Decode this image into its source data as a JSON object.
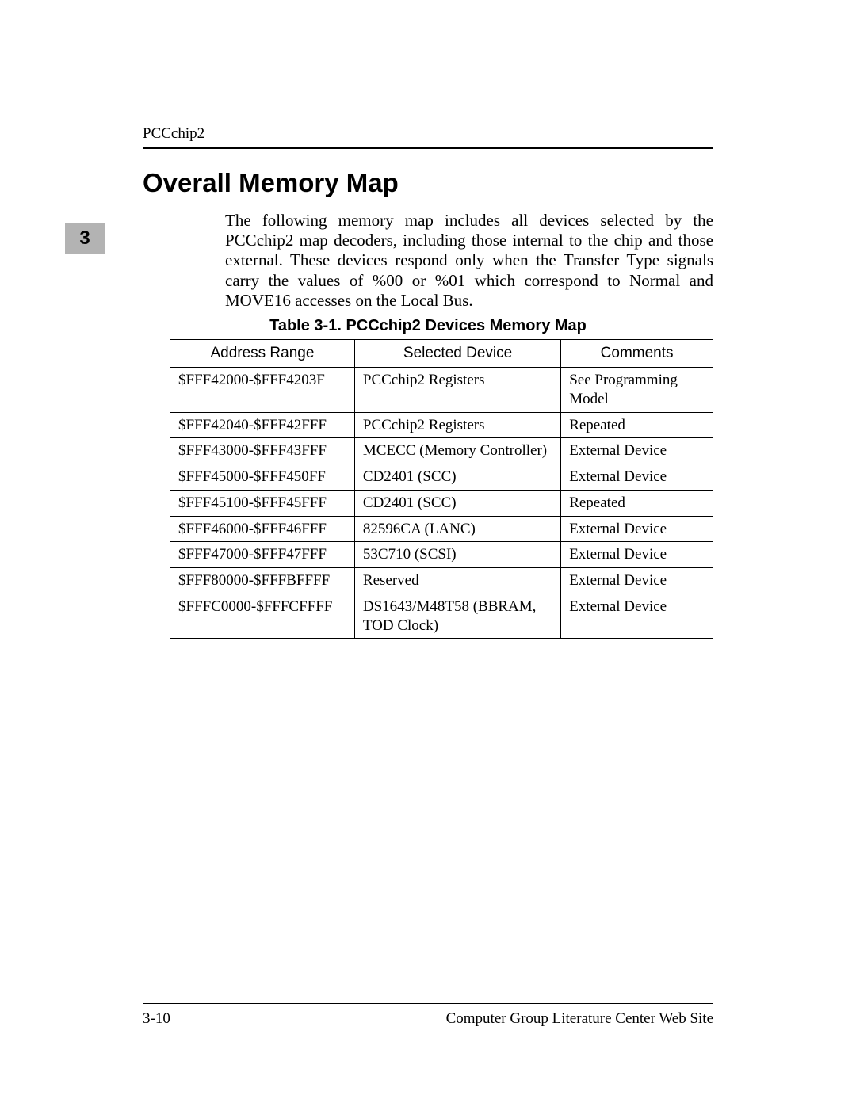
{
  "header": {
    "running_head": "PCCchip2",
    "chapter_tab": "3"
  },
  "section": {
    "title": "Overall Memory Map",
    "intro": "The following memory map includes all devices selected by the PCCchip2 map decoders, including those internal to the chip and those external. These devices respond only when the Transfer Type signals carry the values of %00 or %01 which correspond to Normal and MOVE16 accesses on the Local Bus."
  },
  "table": {
    "caption": "Table 3-1.  PCCchip2 Devices Memory Map",
    "headers": {
      "address": "Address Range",
      "device": "Selected Device",
      "comments": "Comments"
    },
    "rows": [
      {
        "address": "$FFF42000-$FFF4203F",
        "device": "PCCchip2 Registers",
        "comments": "See Programming Model"
      },
      {
        "address": "$FFF42040-$FFF42FFF",
        "device": "PCCchip2 Registers",
        "comments": "Repeated"
      },
      {
        "address": "$FFF43000-$FFF43FFF",
        "device": "MCECC (Memory Controller)",
        "comments": "External Device"
      },
      {
        "address": "$FFF45000-$FFF450FF",
        "device": "CD2401 (SCC)",
        "comments": "External Device"
      },
      {
        "address": "$FFF45100-$FFF45FFF",
        "device": "CD2401 (SCC)",
        "comments": "Repeated"
      },
      {
        "address": "$FFF46000-$FFF46FFF",
        "device": "82596CA (LANC)",
        "comments": "External Device"
      },
      {
        "address": "$FFF47000-$FFF47FFF",
        "device": "53C710 (SCSI)",
        "comments": "External Device"
      },
      {
        "address": "$FFF80000-$FFFBFFFF",
        "device": "Reserved",
        "comments": "External Device"
      },
      {
        "address": "$FFFC0000-$FFFCFFFF",
        "device": "DS1643/M48T58 (BBRAM, TOD Clock)",
        "comments": "External Device"
      }
    ]
  },
  "footer": {
    "page_number": "3-10",
    "site": "Computer Group Literature Center Web Site"
  }
}
